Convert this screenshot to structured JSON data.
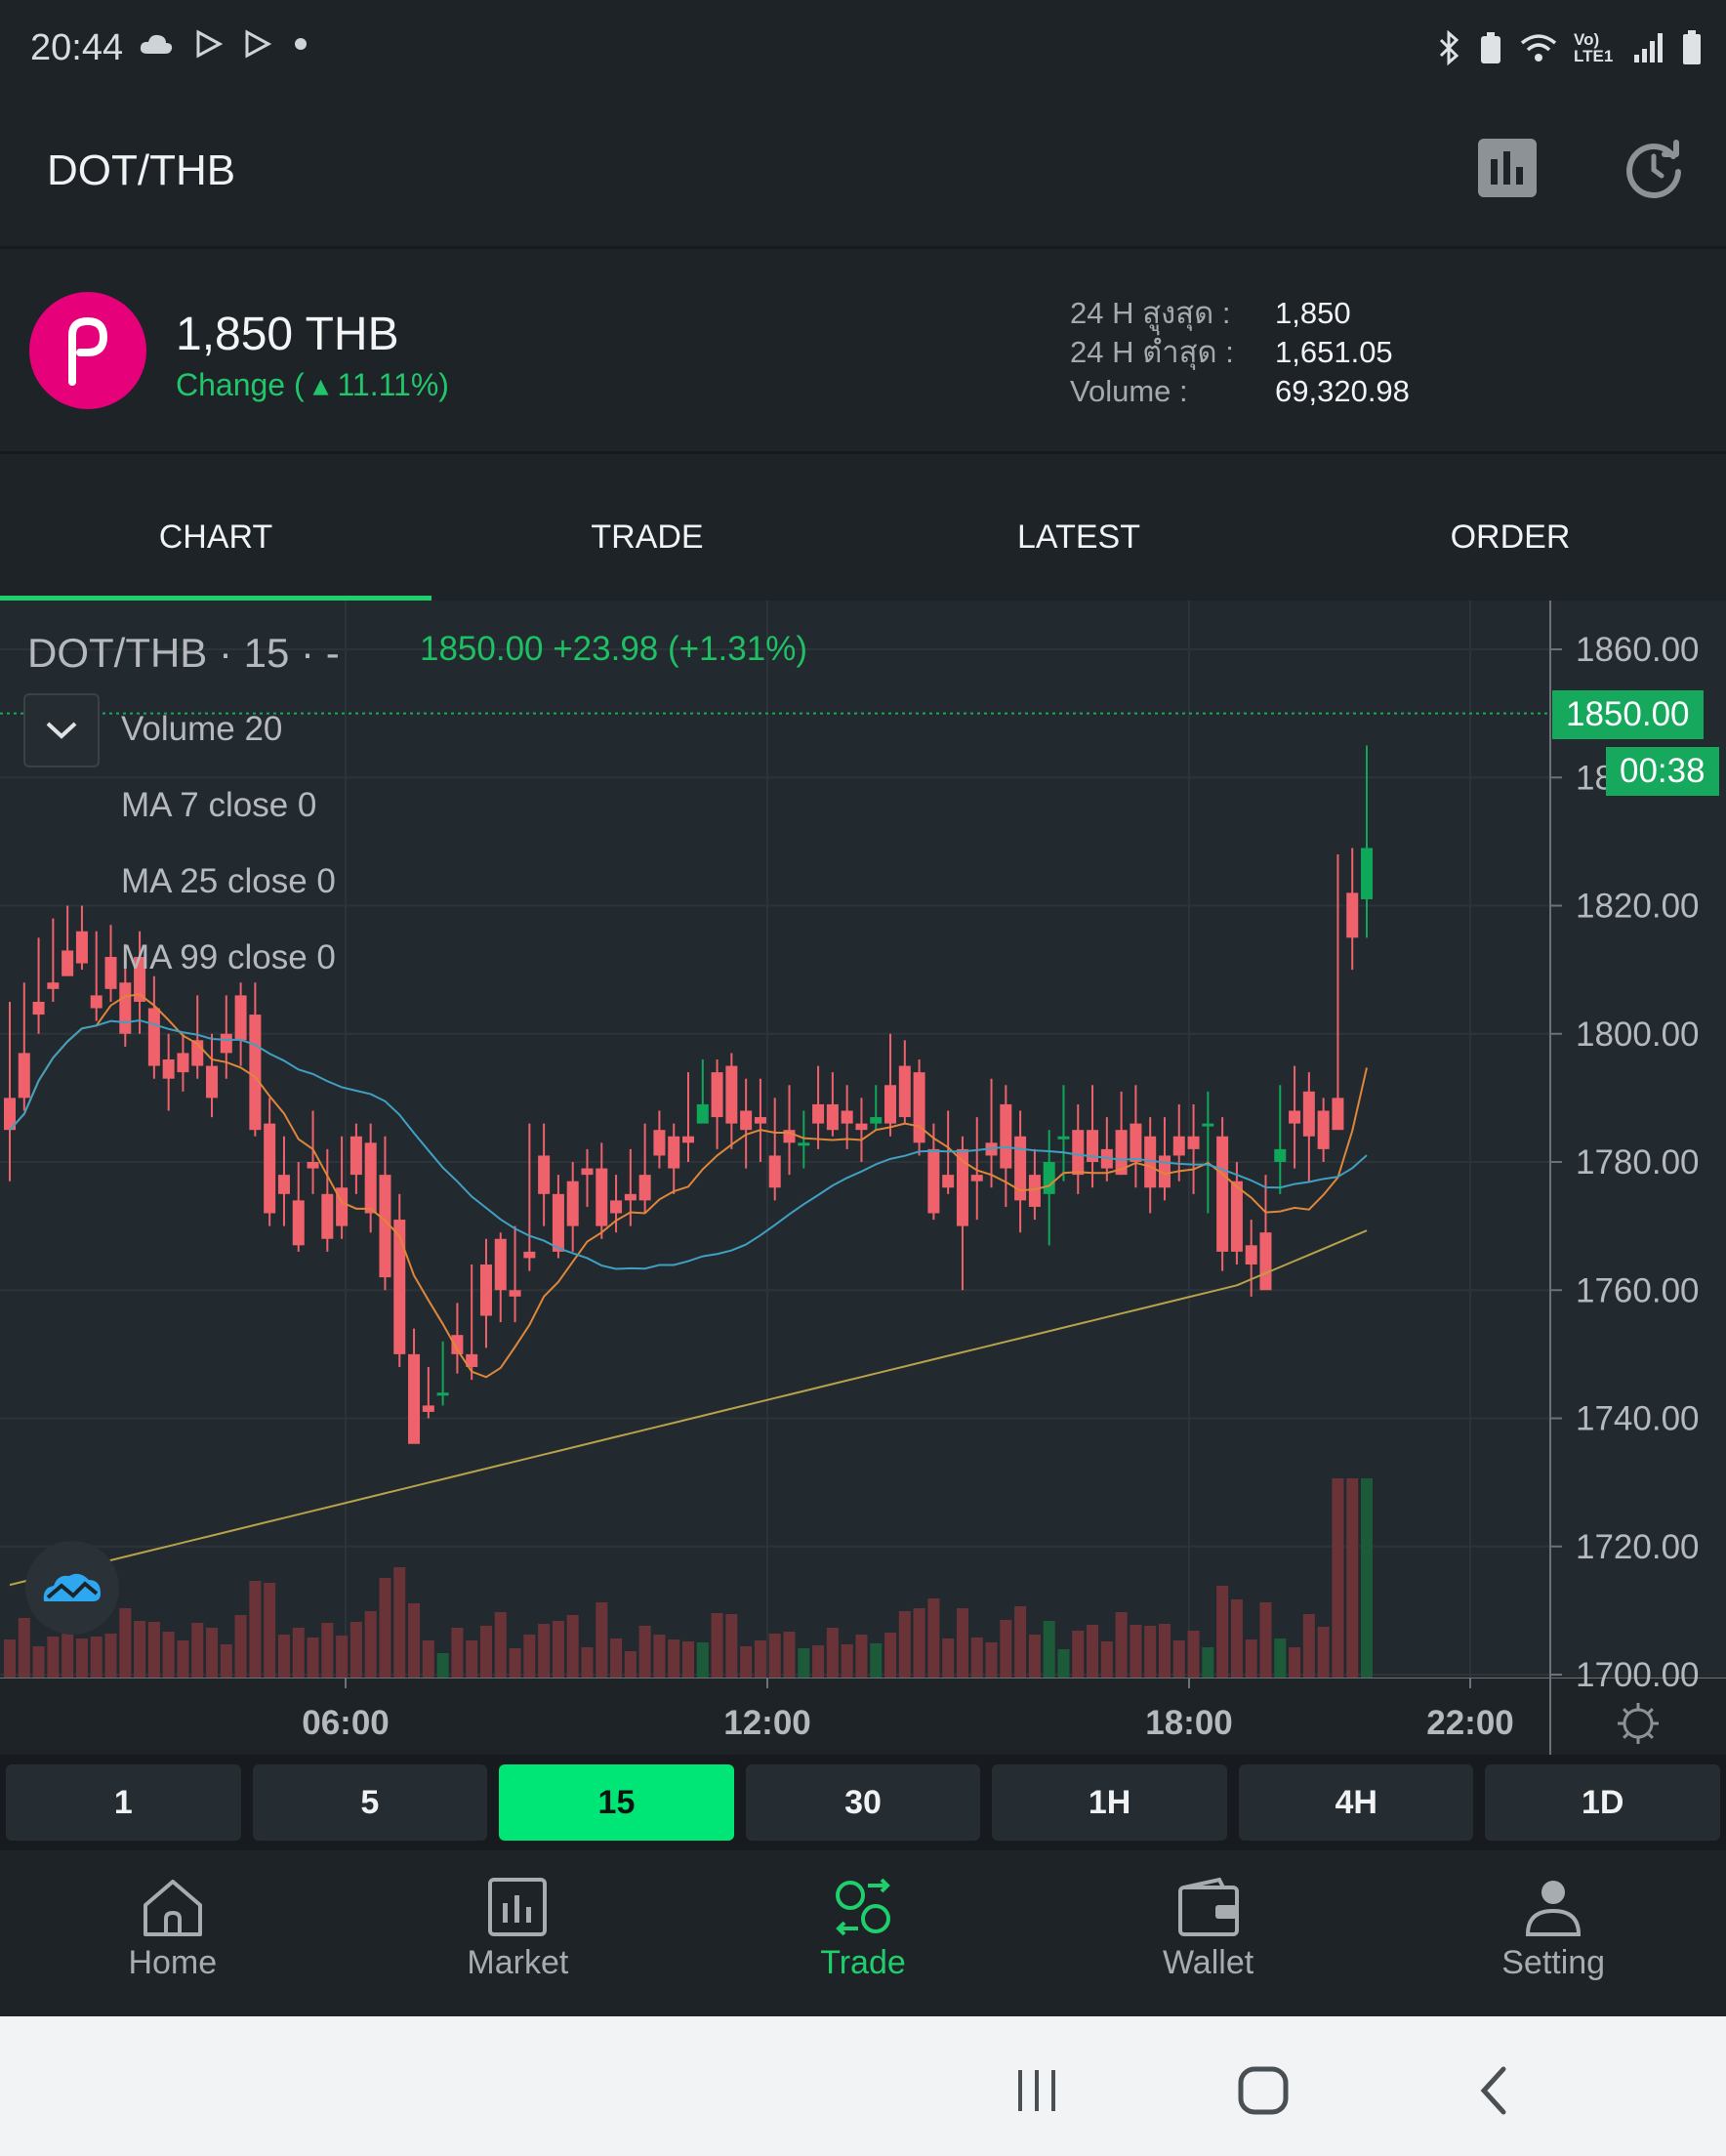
{
  "status_bar": {
    "time": "20:44",
    "network": "Vo) LTE1"
  },
  "header": {
    "title": "DOT/THB",
    "chart_toggle_icon": "bar-chart-icon",
    "refresh_icon": "refresh-clock-icon"
  },
  "ticker": {
    "logo_icon": "polkadot-icon",
    "price": "1,850 THB",
    "change": "Change ( ▴ 11.11%)",
    "stats": [
      {
        "label": "24 H สูงสุด :",
        "value": "1,850"
      },
      {
        "label": "24 H ต่ำสุด :",
        "value": "1,651.05"
      },
      {
        "label": "Volume :",
        "value": "69,320.98"
      }
    ]
  },
  "tabs": [
    {
      "label": "CHART",
      "active": true
    },
    {
      "label": "TRADE",
      "active": false
    },
    {
      "label": "LATEST",
      "active": false
    },
    {
      "label": "ORDER",
      "active": false
    }
  ],
  "chart": {
    "legend_title": "DOT/THB · 15 · -",
    "legend_price": "1850.00  +23.98 (+1.31%)",
    "indicators": [
      "Volume 20",
      "MA 7 close 0",
      "MA 25 close 0",
      "MA 99 close 0"
    ],
    "last_price_badge": "1850.00",
    "countdown_badge": "00:38",
    "settings_icon": "gear-icon",
    "colors": {
      "up": "#0fa85a",
      "down": "#f0626b",
      "ma7": "#e0863a",
      "ma25": "#3fa0c2",
      "ma99": "#b7a24a"
    }
  },
  "chart_data": {
    "type": "candlestick",
    "ylim": [
      1700,
      1860
    ],
    "y_ticks": [
      "1860.00",
      "1840.00",
      "1820.00",
      "1800.00",
      "1780.00",
      "1760.00",
      "1740.00",
      "1720.00",
      "1700.00"
    ],
    "x_ticks": [
      "06:00",
      "12:00",
      "18:00",
      "22:00"
    ],
    "candles": [
      [
        1790,
        1805,
        1785,
        1777
      ],
      [
        1797,
        1808,
        1790,
        1788
      ],
      [
        1805,
        1815,
        1803,
        1800
      ],
      [
        1808,
        1818,
        1807,
        1805
      ],
      [
        1813,
        1820,
        1809,
        1810
      ],
      [
        1816,
        1820,
        1811,
        1810
      ],
      [
        1806,
        1816,
        1804,
        1802
      ],
      [
        1812,
        1817,
        1807,
        1805
      ],
      [
        1808,
        1814,
        1800,
        1798
      ],
      [
        1812,
        1816,
        1805,
        1800
      ],
      [
        1804,
        1809,
        1795,
        1793
      ],
      [
        1796,
        1800,
        1793,
        1788
      ],
      [
        1797,
        1800,
        1794,
        1791
      ],
      [
        1799,
        1806,
        1795,
        1793
      ],
      [
        1795,
        1800,
        1790,
        1787
      ],
      [
        1800,
        1806,
        1797,
        1793
      ],
      [
        1806,
        1808,
        1799,
        1795
      ],
      [
        1803,
        1808,
        1785,
        1784
      ],
      [
        1786,
        1790,
        1772,
        1770
      ],
      [
        1778,
        1784,
        1775,
        1770
      ],
      [
        1774,
        1780,
        1767,
        1766
      ],
      [
        1780,
        1788,
        1779,
        1775
      ],
      [
        1775,
        1782,
        1768,
        1766
      ],
      [
        1776,
        1784,
        1770,
        1768
      ],
      [
        1784,
        1786,
        1778,
        1775
      ],
      [
        1783,
        1786,
        1772,
        1769
      ],
      [
        1778,
        1784,
        1762,
        1760
      ],
      [
        1771,
        1775,
        1750,
        1748
      ],
      [
        1750,
        1754,
        1736,
        1739
      ],
      [
        1742,
        1748,
        1741,
        1740
      ],
      [
        1744,
        1752,
        1744,
        1742
      ],
      [
        1753,
        1758,
        1750,
        1747
      ],
      [
        1750,
        1764,
        1748,
        1746
      ],
      [
        1764,
        1768,
        1756,
        1751
      ],
      [
        1768,
        1769,
        1760,
        1755
      ],
      [
        1760,
        1770,
        1759,
        1755
      ],
      [
        1766,
        1786,
        1765,
        1763
      ],
      [
        1781,
        1786,
        1775,
        1770
      ],
      [
        1775,
        1778,
        1766,
        1765
      ],
      [
        1777,
        1780,
        1770,
        1766
      ],
      [
        1779,
        1782,
        1778,
        1773
      ],
      [
        1779,
        1783,
        1770,
        1768
      ],
      [
        1774,
        1778,
        1772,
        1769
      ],
      [
        1775,
        1782,
        1774,
        1770
      ],
      [
        1778,
        1786,
        1774,
        1772
      ],
      [
        1785,
        1788,
        1781,
        1779
      ],
      [
        1784,
        1786,
        1779,
        1775
      ],
      [
        1784,
        1794,
        1783,
        1780
      ],
      [
        1786,
        1796,
        1789,
        1788
      ],
      [
        1794,
        1796,
        1787,
        1782
      ],
      [
        1795,
        1797,
        1786,
        1782
      ],
      [
        1788,
        1793,
        1785,
        1779
      ],
      [
        1787,
        1793,
        1786,
        1780
      ],
      [
        1781,
        1790,
        1776,
        1774
      ],
      [
        1785,
        1792,
        1783,
        1778
      ],
      [
        1783,
        1788,
        1783,
        1779
      ],
      [
        1789,
        1795,
        1786,
        1782
      ],
      [
        1789,
        1794,
        1785,
        1784
      ],
      [
        1788,
        1792,
        1786,
        1782
      ],
      [
        1786,
        1790,
        1785,
        1780
      ],
      [
        1786,
        1792,
        1787,
        1785
      ],
      [
        1792,
        1800,
        1786,
        1784
      ],
      [
        1795,
        1799,
        1787,
        1786
      ],
      [
        1794,
        1796,
        1783,
        1781
      ],
      [
        1782,
        1786,
        1772,
        1771
      ],
      [
        1778,
        1788,
        1776,
        1775
      ],
      [
        1782,
        1784,
        1770,
        1760
      ],
      [
        1778,
        1787,
        1777,
        1771
      ],
      [
        1783,
        1793,
        1781,
        1776
      ],
      [
        1789,
        1792,
        1779,
        1773
      ],
      [
        1784,
        1788,
        1774,
        1769
      ],
      [
        1778,
        1782,
        1773,
        1771
      ],
      [
        1775,
        1785,
        1780,
        1767
      ],
      [
        1784,
        1792,
        1784,
        1777
      ],
      [
        1785,
        1789,
        1778,
        1775
      ],
      [
        1785,
        1792,
        1780,
        1776
      ],
      [
        1782,
        1787,
        1779,
        1777
      ],
      [
        1785,
        1791,
        1778,
        1778
      ],
      [
        1786,
        1792,
        1780,
        1776
      ],
      [
        1784,
        1787,
        1776,
        1772
      ],
      [
        1781,
        1787,
        1776,
        1774
      ],
      [
        1784,
        1789,
        1781,
        1777
      ],
      [
        1784,
        1789,
        1782,
        1775
      ],
      [
        1786,
        1791,
        1786,
        1772
      ],
      [
        1784,
        1787,
        1766,
        1763
      ],
      [
        1777,
        1780,
        1766,
        1764
      ],
      [
        1767,
        1771,
        1764,
        1759
      ],
      [
        1769,
        1778,
        1760,
        1761
      ],
      [
        1780,
        1792,
        1782,
        1775
      ],
      [
        1788,
        1795,
        1786,
        1779
      ],
      [
        1791,
        1794,
        1784,
        1777
      ],
      [
        1788,
        1790,
        1782,
        1780
      ],
      [
        1790,
        1828,
        1785,
        1786
      ],
      [
        1822,
        1829,
        1815,
        1810
      ],
      [
        1821,
        1845,
        1829,
        1815
      ]
    ],
    "candle_format": [
      "open",
      "high",
      "close",
      "low"
    ],
    "volume_peak_labels": []
  },
  "intervals": [
    {
      "label": "1",
      "active": false
    },
    {
      "label": "5",
      "active": false
    },
    {
      "label": "15",
      "active": true
    },
    {
      "label": "30",
      "active": false
    },
    {
      "label": "1H",
      "active": false
    },
    {
      "label": "4H",
      "active": false
    },
    {
      "label": "1D",
      "active": false
    }
  ],
  "bottom_nav": [
    {
      "label": "Home",
      "icon": "home-icon",
      "active": false
    },
    {
      "label": "Market",
      "icon": "market-icon",
      "active": false
    },
    {
      "label": "Trade",
      "icon": "trade-icon",
      "active": true
    },
    {
      "label": "Wallet",
      "icon": "wallet-icon",
      "active": false
    },
    {
      "label": "Setting",
      "icon": "user-icon",
      "active": false
    }
  ],
  "system_nav": {
    "recents_icon": "recents-icon",
    "home_icon": "home-square-icon",
    "back_icon": "back-icon"
  }
}
